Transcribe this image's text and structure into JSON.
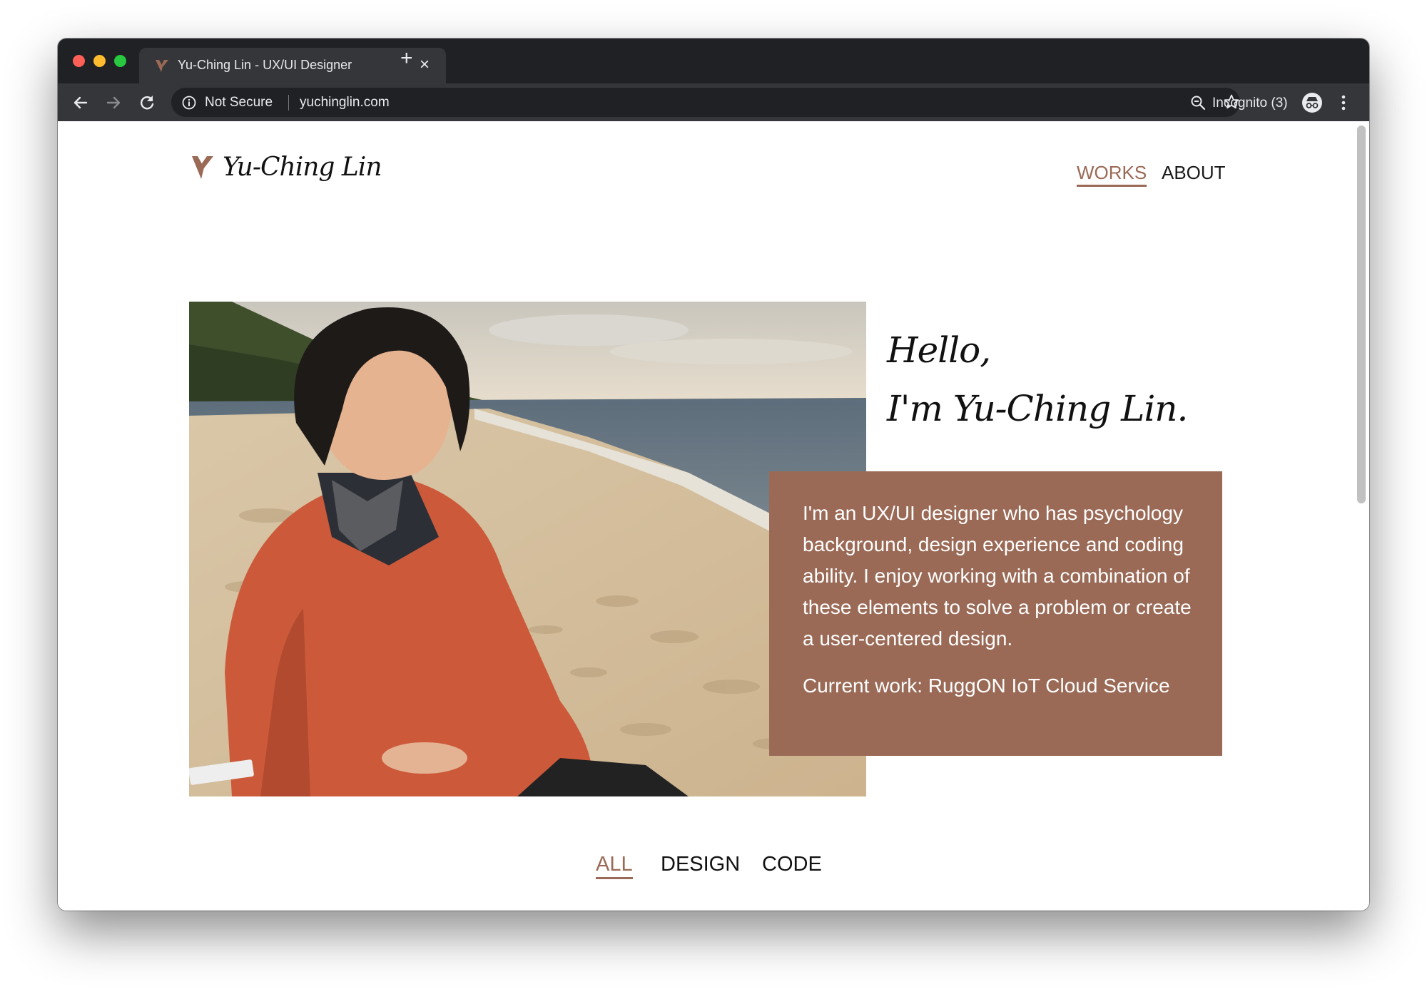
{
  "browser": {
    "tab": {
      "title": "Yu-Ching Lin - UX/UI Designer",
      "close_icon": "×",
      "new_tab_icon": "+"
    },
    "address_bar": {
      "security_label": "Not Secure",
      "url": "yuchinglin.com"
    },
    "profile": {
      "label": "Incognito (3)"
    },
    "icons": [
      "back-icon",
      "forward-icon",
      "reload-icon",
      "info-icon",
      "zoom-icon",
      "star-icon",
      "incognito-icon",
      "menu-icon"
    ]
  },
  "site": {
    "logo_text": "Yu-Ching Lin",
    "nav": {
      "works": "WORKS",
      "about": "ABOUT"
    },
    "hero": {
      "greeting_line1": "Hello,",
      "greeting_line2": "I'm Yu-Ching Lin.",
      "intro": "I'm an UX/UI designer who has psychology background, design experience and coding ability. I enjoy working with a combination of these elements to solve a problem or create a user-centered design.",
      "current_work": "Current work: RuggON IoT Cloud Service"
    },
    "filters": {
      "all": "ALL",
      "design": "DESIGN",
      "code": "CODE"
    }
  },
  "colors": {
    "accent": "#9a6a56",
    "tabstrip": "#202124",
    "toolbar": "#35363a"
  }
}
